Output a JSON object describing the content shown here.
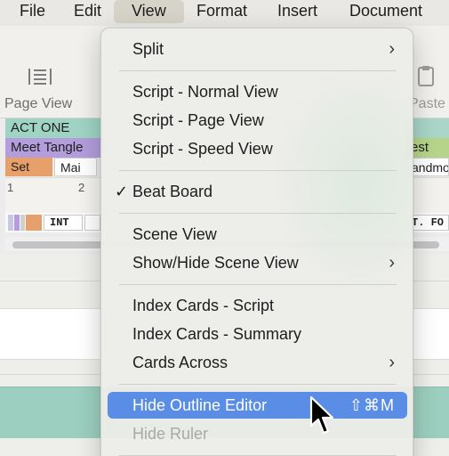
{
  "menubar": {
    "file": "File",
    "edit": "Edit",
    "view": "View",
    "format": "Format",
    "insert": "Insert",
    "document": "Document"
  },
  "toolbar": {
    "page_view_label": "Page View",
    "paste_label": "Paste",
    "page_view_icon": "page-lines-icon",
    "paste_icon": "clipboard-icon"
  },
  "outline": {
    "act": "ACT ONE",
    "beat": "Meet Tangle",
    "beat_right": "est",
    "lane_set": "Set",
    "lane_mai": "Mai",
    "lane_right": "andmo",
    "ruler_1": "1",
    "ruler_2": "2",
    "scene_int": "INT",
    "scene_right": "T. FO"
  },
  "view_menu": {
    "split": "Split",
    "script_normal": "Script - Normal View",
    "script_page": "Script - Page View",
    "script_speed": "Script - Speed View",
    "beat_board": "Beat Board",
    "beat_board_check": "✓",
    "scene_view": "Scene View",
    "show_hide_scene": "Show/Hide Scene View",
    "index_script": "Index Cards - Script",
    "index_summary": "Index Cards - Summary",
    "cards_across": "Cards Across",
    "hide_outline": "Hide Outline Editor",
    "hide_outline_shortcut": "⇧⌘M",
    "hide_ruler": "Hide Ruler"
  },
  "colors": {
    "menu_highlight": "#5a8ee6",
    "act_green": "#9fd3c4",
    "beat_purple": "#b39ddb",
    "set_orange": "#e8a06a"
  }
}
